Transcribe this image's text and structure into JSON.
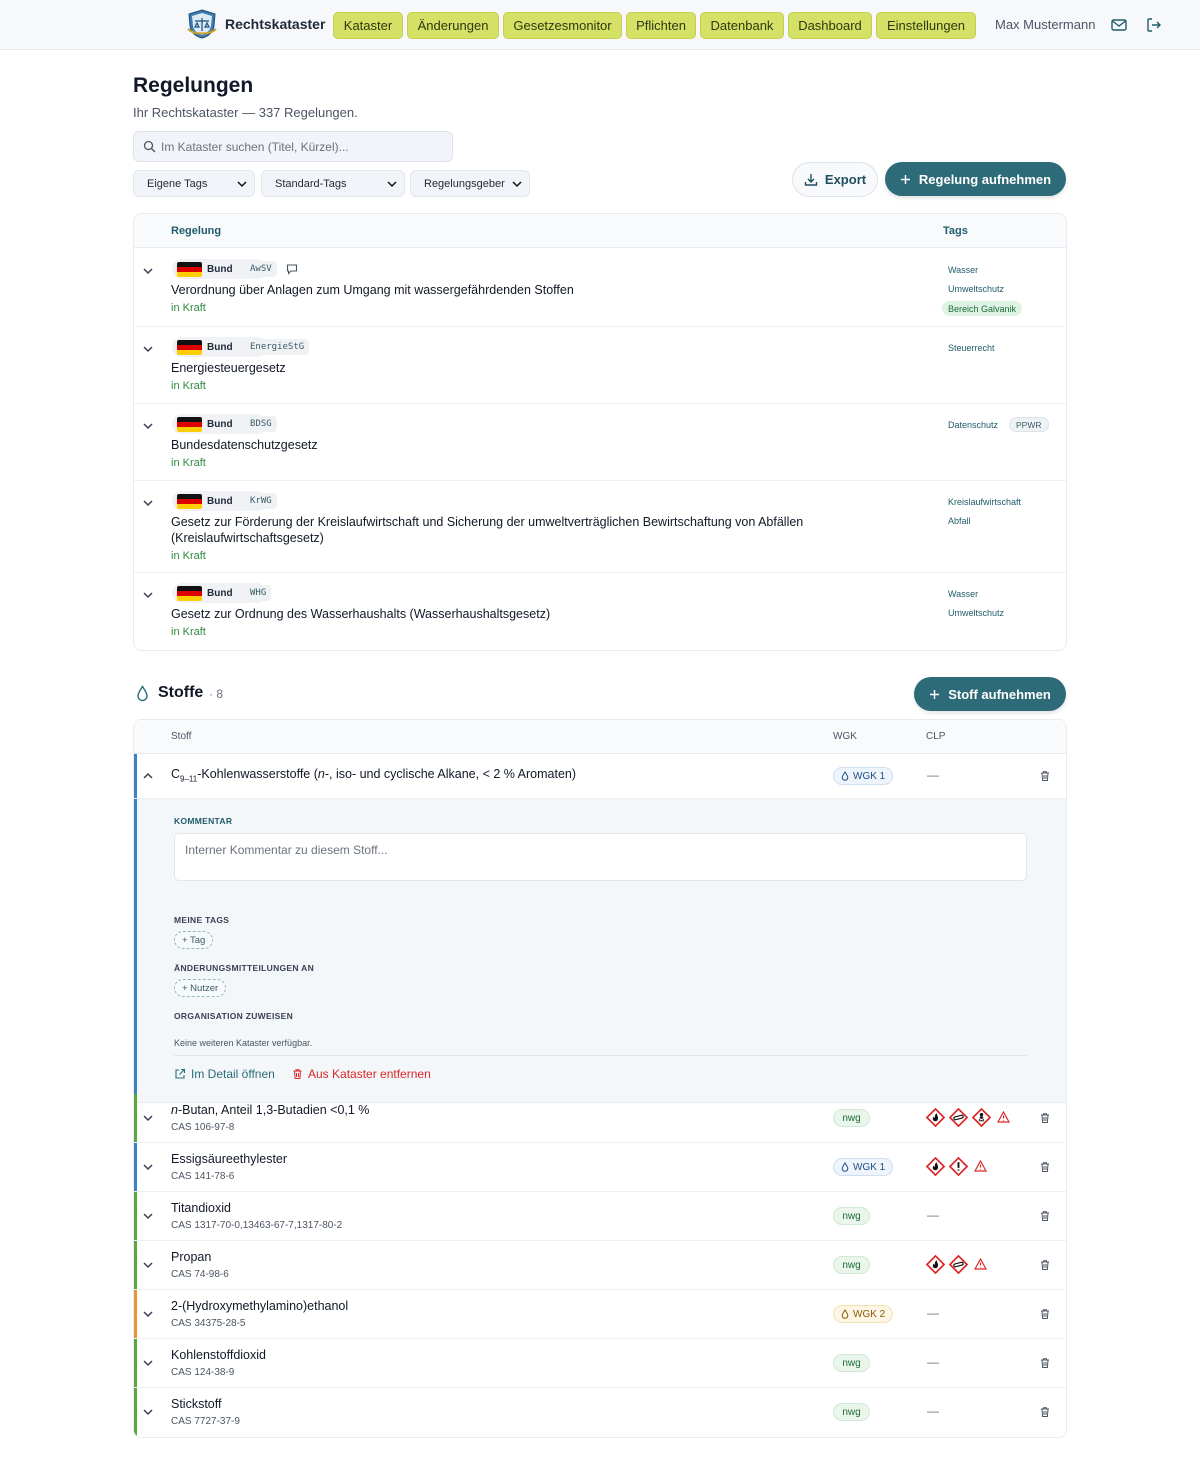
{
  "nav": {
    "brand": "Rechtskataster",
    "items": [
      "Kataster",
      "Änderungen",
      "Gesetzesmonitor",
      "Pflichten",
      "Datenbank",
      "Dashboard",
      "Einstellungen"
    ],
    "user": "Max Mustermann",
    "icons": [
      "mail-icon",
      "logout-icon"
    ],
    "accent_color": "#d5e066"
  },
  "page": {
    "title": "Regelungen",
    "subtitle": "Ihr Rechtskataster — 337 Regelungen.",
    "search_placeholder": "Im Kataster suchen (Titel, Kürzel)...",
    "filters": [
      "Eigene Tags",
      "Standard-Tags",
      "Regelungsgeber"
    ],
    "export_label": "Export",
    "add_label": "Regelung aufnehmen",
    "primary_color": "#2d6b78"
  },
  "regulations": {
    "columns": [
      "Regelung",
      "Tags"
    ],
    "rows": [
      {
        "level": "Bund",
        "abbr": "AwSV",
        "has_comment": true,
        "title": "Verordnung über Anlagen zum Umgang mit wassergefährdenden Stoffen",
        "status": "in Kraft",
        "tags": [
          "Wasser",
          "Umweltschutz"
        ],
        "highlight_tag": "Bereich Galvanik"
      },
      {
        "level": "Bund",
        "abbr": "EnergieStG",
        "title": "Energiesteuergesetz",
        "status": "in Kraft",
        "tags": [
          "Steuerrecht"
        ]
      },
      {
        "level": "Bund",
        "abbr": "BDSG",
        "title": "Bundesdatenschutzgesetz",
        "status": "in Kraft",
        "tags": [
          "Datenschutz"
        ],
        "gray_tag": "PPWR"
      },
      {
        "level": "Bund",
        "abbr": "KrWG",
        "title": "Gesetz zur Förderung der Kreislaufwirtschaft und Sicherung der umweltverträglichen Bewirtschaftung von Abfällen",
        "title_line2": "(Kreislaufwirtschaftsgesetz)",
        "status": "in Kraft",
        "tags": [
          "Kreislaufwirtschaft",
          "Abfall"
        ]
      },
      {
        "level": "Bund",
        "abbr": "WHG",
        "title": "Gesetz zur Ordnung des Wasserhaushalts (Wasserhaushaltsgesetz)",
        "status": "in Kraft",
        "tags": [
          "Wasser",
          "Umweltschutz"
        ]
      }
    ]
  },
  "substances": {
    "title": "Stoffe",
    "count": "· 8",
    "add_label": "Stoff aufnehmen",
    "columns": [
      "Stoff",
      "WGK",
      "CLP"
    ],
    "expanded": {
      "name_prefix": "C",
      "name_sub": "9–11",
      "name_rest_1": "-Kohlenwasserstoffe (",
      "name_italic": "n",
      "name_rest_2": "-, iso- und cyclische Alkane, < 2 % Aromaten)",
      "wgk": "WGK 1",
      "clp": "—",
      "comment_label": "KOMMENTAR",
      "comment_placeholder": "Interner Kommentar zu diesem Stoff...",
      "tags_label": "MEINE TAGS",
      "add_tag": "+ Tag",
      "notify_label": "ÄNDERUNGSMITTEILUNGEN AN",
      "add_user": "+ Nutzer",
      "org_label": "ORGANISATION ZUWEISEN",
      "org_note": "Keine weiteren Kataster verfügbar.",
      "open_detail": "Im Detail öffnen",
      "remove": "Aus Kataster entfernen"
    },
    "rows": [
      {
        "name_italic": "n",
        "name": "-Butan, Anteil 1,3-Butadien <0,1 %",
        "cas": "CAS 106-97-8",
        "wgk": "nwg",
        "clp": [
          "flame",
          "gas-cylinder",
          "health-hazard",
          "warning"
        ]
      },
      {
        "name": "Essigsäureethylester",
        "cas": "CAS 141-78-6",
        "wgk": "WGK 1",
        "clp": [
          "flame",
          "exclamation",
          "warning"
        ]
      },
      {
        "name": "Titandioxid",
        "cas": "CAS 1317-70-0,13463-67-7,1317-80-2",
        "wgk": "nwg",
        "clp": "—"
      },
      {
        "name": "Propan",
        "cas": "CAS 74-98-6",
        "wgk": "nwg",
        "clp": [
          "flame",
          "gas-cylinder",
          "warning"
        ]
      },
      {
        "name": "2-(Hydroxymethylamino)ethanol",
        "cas": "CAS 34375-28-5",
        "wgk": "WGK 2",
        "clp": "—"
      },
      {
        "name": "Kohlenstoffdioxid",
        "cas": "CAS 124-38-9",
        "wgk": "nwg",
        "clp": "—"
      },
      {
        "name": "Stickstoff",
        "cas": "CAS 7727-37-9",
        "wgk": "nwg",
        "clp": "—"
      }
    ],
    "colors": {
      "wgk1": "#3b82c4",
      "nwg": "#5aa83a",
      "wgk2": "#e8923a"
    }
  }
}
